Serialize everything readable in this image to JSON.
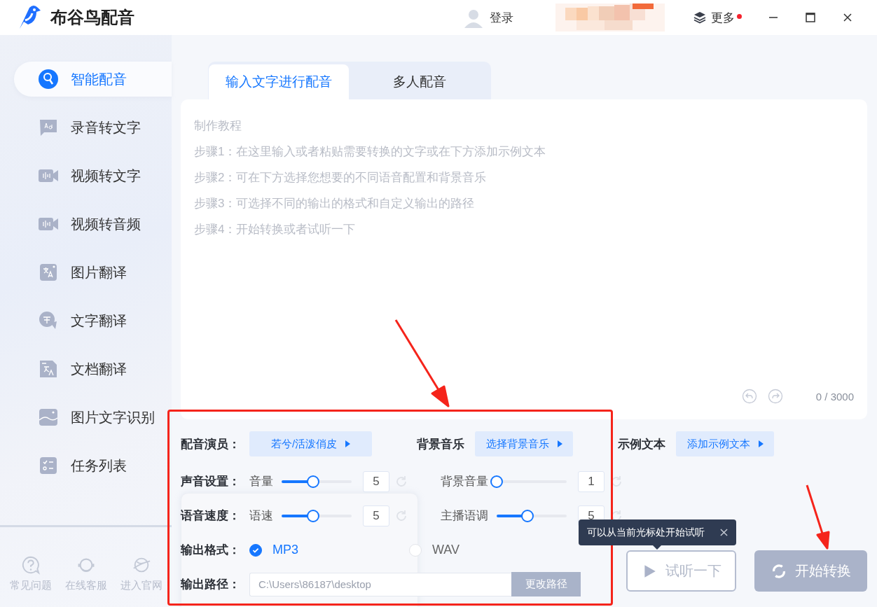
{
  "app": {
    "name": "布谷鸟配音"
  },
  "header": {
    "login": "登录",
    "more": "更多",
    "more_badge": true
  },
  "sidebar": {
    "items": [
      {
        "label": "智能配音",
        "selected": true
      },
      {
        "label": "录音转文字",
        "selected": false
      },
      {
        "label": "视频转文字",
        "selected": false
      },
      {
        "label": "视频转音频",
        "selected": false
      },
      {
        "label": "图片翻译",
        "selected": false
      },
      {
        "label": "文字翻译",
        "selected": false
      },
      {
        "label": "文档翻译",
        "selected": false
      },
      {
        "label": "图片文字识别",
        "selected": false
      },
      {
        "label": "任务列表",
        "selected": false
      }
    ],
    "footer": [
      {
        "label": "常见问题"
      },
      {
        "label": "在线客服"
      },
      {
        "label": "进入官网"
      }
    ]
  },
  "tabs": [
    {
      "label": "输入文字进行配音",
      "selected": true
    },
    {
      "label": "多人配音",
      "selected": false
    }
  ],
  "editor": {
    "placeholder": [
      "制作教程",
      "步骤1：在这里输入或者粘贴需要转换的文字或在下方添加示例文本",
      "步骤2：可在下方选择您想要的不同语音配置和背景音乐",
      "步骤3：可选择不同的输出的格式和自定义输出的路径",
      "步骤4：开始转换或者试听一下"
    ],
    "counter": "0 / 3000"
  },
  "pickers": [
    {
      "label": "配音演员：",
      "value": "若兮/活泼俏皮"
    },
    {
      "label": "背景音乐",
      "value": "选择背景音乐"
    },
    {
      "label": "示例文本",
      "value": "添加示例文本"
    }
  ],
  "slider_rows": [
    {
      "label": "声音设置：",
      "sliders": [
        {
          "name": "音量",
          "level": 0.45,
          "value": "5"
        },
        {
          "name": "背景音量",
          "level": 0,
          "value": "1"
        }
      ]
    },
    {
      "label": "语音速度：",
      "sliders": [
        {
          "name": "语速",
          "level": 0.45,
          "value": "5"
        },
        {
          "name": "主播语调",
          "level": 0.44,
          "value": "5"
        }
      ]
    }
  ],
  "format": {
    "label": "输出格式：",
    "options": [
      {
        "label": "MP3",
        "selected": true
      },
      {
        "label": "WAV",
        "selected": false
      }
    ]
  },
  "output_path": {
    "label": "输出路径：",
    "placeholder": "C:\\Users\\86187\\desktop",
    "button": "更改路径"
  },
  "tooltip": {
    "text": "可以从当前光标处开始试听"
  },
  "actions": [
    {
      "label": "试听一下",
      "kind": "preview"
    },
    {
      "label": "开始转换",
      "kind": "convert"
    }
  ]
}
